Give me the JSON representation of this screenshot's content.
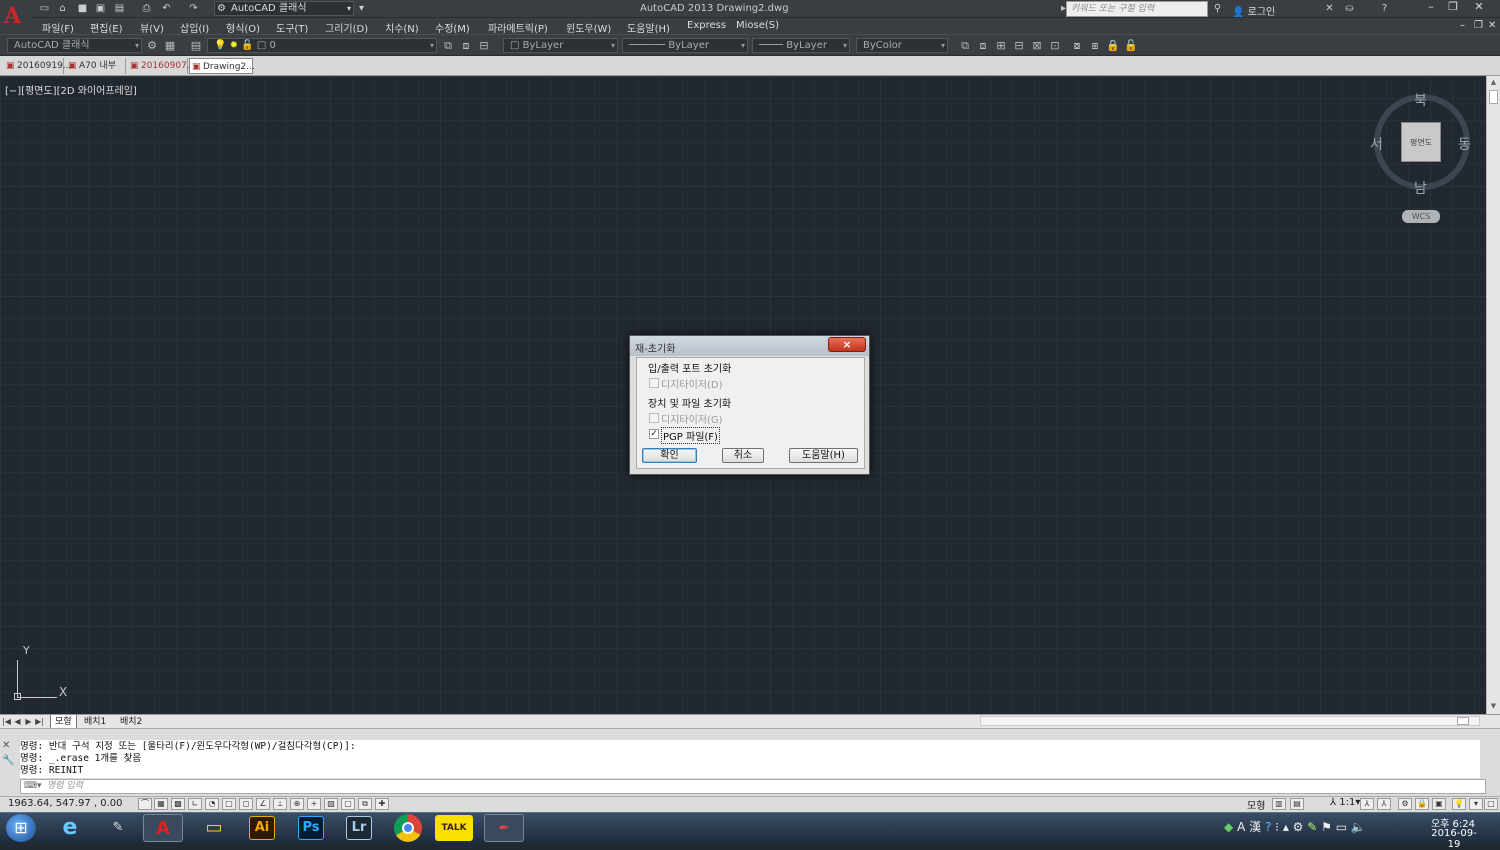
{
  "app": {
    "title": "AutoCAD 2013    Drawing2.dwg",
    "workspace": "AutoCAD 클래식",
    "search_placeholder": "키워드 또는 구절 입력",
    "login": "로그인"
  },
  "menu": [
    "파일(F)",
    "편집(E)",
    "뷰(V)",
    "삽입(I)",
    "형식(O)",
    "도구(T)",
    "그리기(D)",
    "치수(N)",
    "수정(M)",
    "파라메트릭(P)",
    "윈도우(W)",
    "도움말(H)",
    "Express",
    "Miose(S)"
  ],
  "toolbar": {
    "workspace_combo": "AutoCAD 클래식",
    "layer_value": "0",
    "color_combo": "ByLayer",
    "linetype_combo": "ByLayer",
    "lineweight_combo": "ByLayer",
    "plotstyle_combo": "ByColor"
  },
  "file_tabs": [
    "20160919...",
    "A70 내부",
    "20160907...",
    "Drawing2..."
  ],
  "viewport_label": "[−][평면도][2D 와이어프레임]",
  "viewcube": {
    "face": "평면도",
    "north": "북",
    "south": "남",
    "east": "동",
    "west": "서",
    "wcs": "WCS"
  },
  "ucs": {
    "x": "X",
    "y": "Y"
  },
  "layout_tabs": [
    "모형",
    "배치1",
    "배치2"
  ],
  "command": {
    "history": [
      "명령: 반대 구석 지정 또는 [울타리(F)/윈도우다각형(WP)/걸침다각형(CP)]:",
      "명령: _.erase 1개를 찾음",
      "명령: REINIT"
    ],
    "input_placeholder": "명령 입력"
  },
  "status": {
    "coords": "1963.64,  547.97 , 0.00",
    "model": "모형",
    "scale": "1:1"
  },
  "taskbar": {
    "apps": [
      "IE",
      "App",
      "AutoCAD",
      "Explorer",
      "Ai",
      "Ps",
      "Lr",
      "Chrome",
      "TALK",
      "Pen"
    ],
    "time": "오후 6:24",
    "date": "2016-09-19"
  },
  "dialog": {
    "title": "재-초기화",
    "close": "×",
    "group1": "입/출력 포트 초기화",
    "group1_digitizer": "디지타이저(D)",
    "group2": "장치 및 파일 초기화",
    "group2_digitizer": "디지타이저(G)",
    "pgp": "PGP 파일(F)",
    "ok": "확인",
    "cancel": "취소",
    "help": "도움말(H)"
  }
}
